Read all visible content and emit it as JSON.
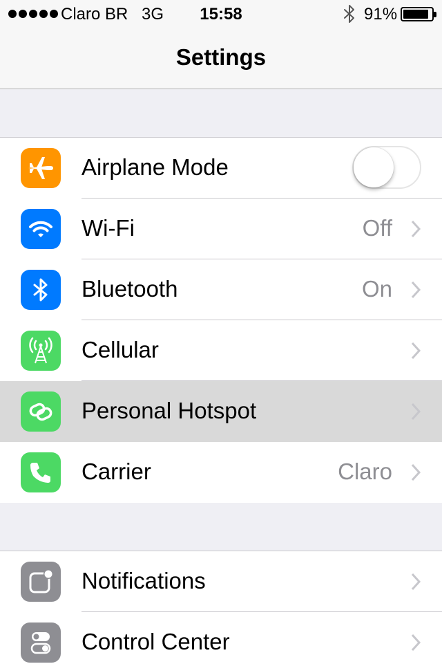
{
  "status_bar": {
    "carrier": "Claro BR",
    "network": "3G",
    "time": "15:58",
    "battery": "91%",
    "battery_level": 0.91
  },
  "nav": {
    "title": "Settings"
  },
  "groups": [
    {
      "rows": [
        {
          "label": "Airplane Mode",
          "icon": "airplane-icon",
          "icon_color": "#ff9500",
          "control": "toggle",
          "toggle_on": false
        },
        {
          "label": "Wi-Fi",
          "value": "Off",
          "icon": "wifi-icon",
          "icon_color": "#007aff"
        },
        {
          "label": "Bluetooth",
          "value": "On",
          "icon": "bluetooth-icon",
          "icon_color": "#007aff"
        },
        {
          "label": "Cellular",
          "icon": "cellular-icon",
          "icon_color": "#4cd964"
        },
        {
          "label": "Personal Hotspot",
          "icon": "hotspot-icon",
          "icon_color": "#4cd964",
          "highlighted": true
        },
        {
          "label": "Carrier",
          "value": "Claro",
          "icon": "phone-icon",
          "icon_color": "#4cd964"
        }
      ]
    },
    {
      "rows": [
        {
          "label": "Notifications",
          "icon": "notifications-icon",
          "icon_color": "#8e8e93"
        },
        {
          "label": "Control Center",
          "icon": "control-center-icon",
          "icon_color": "#8e8e93"
        }
      ]
    }
  ]
}
